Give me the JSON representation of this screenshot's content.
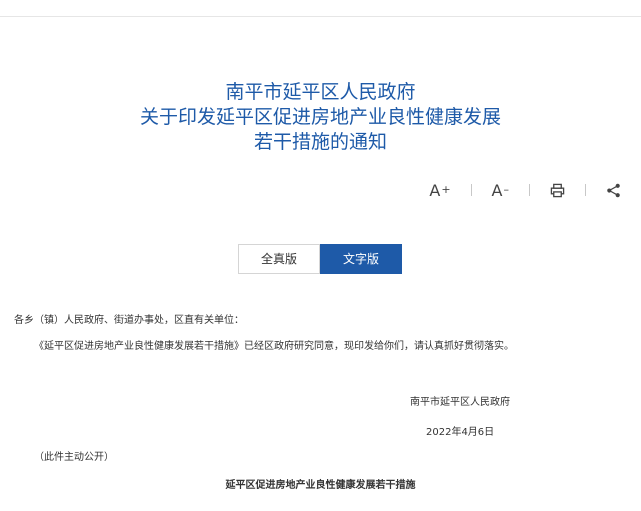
{
  "header": {
    "title_lines": [
      "南平市延平区人民政府",
      "关于印发延平区促进房地产业良性健康发展",
      "若干措施的通知"
    ]
  },
  "toolbar": {
    "font_increase": {
      "label": "A",
      "suffix": "+"
    },
    "font_decrease": {
      "label": "A",
      "suffix": "–"
    },
    "print_icon": "printer-icon",
    "share_icon": "share-icon"
  },
  "view_tabs": {
    "items": [
      {
        "label": "全真版",
        "active": false
      },
      {
        "label": "文字版",
        "active": true
      }
    ]
  },
  "body": {
    "salutation": "各乡（镇）人民政府、街道办事处，区直有关单位：",
    "content": "《延平区促进房地产业良性健康发展若干措施》已经区政府研究同意，现印发给你们，请认真抓好贯彻落实。",
    "signature": "南平市延平区人民政府",
    "date": "2022年4月6日",
    "disclosure": "（此件主动公开）",
    "attachment_title": "延平区促进房地产业良性健康发展若干措施"
  },
  "colors": {
    "accent": "#1e5aa8",
    "text": "#333333"
  }
}
